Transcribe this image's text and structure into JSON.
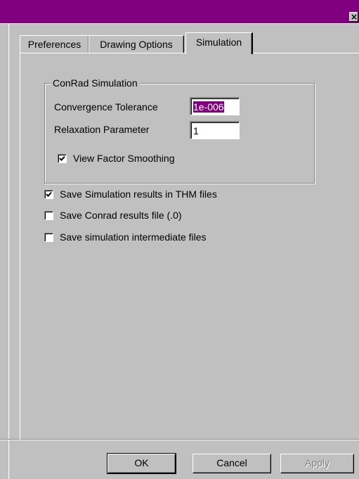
{
  "window": {
    "close_glyph": "×",
    "title_color": "#800080"
  },
  "tabs": [
    {
      "label": "Preferences"
    },
    {
      "label": "Drawing Options"
    },
    {
      "label": "Simulation"
    }
  ],
  "group": {
    "title": "ConRad Simulation",
    "convergence_label": "Convergence Tolerance",
    "convergence_value": "1e-006",
    "relaxation_label": "Relaxation Parameter",
    "relaxation_value": "1",
    "view_factor": {
      "label": "View Factor Smoothing",
      "checked": true
    }
  },
  "options": [
    {
      "label": "Save Simulation results in THM files",
      "checked": true
    },
    {
      "label": "Save Conrad results file (.0)",
      "checked": false
    },
    {
      "label": "Save simulation intermediate files",
      "checked": false
    }
  ],
  "buttons": {
    "ok": "OK",
    "cancel": "Cancel",
    "apply": "Apply"
  }
}
